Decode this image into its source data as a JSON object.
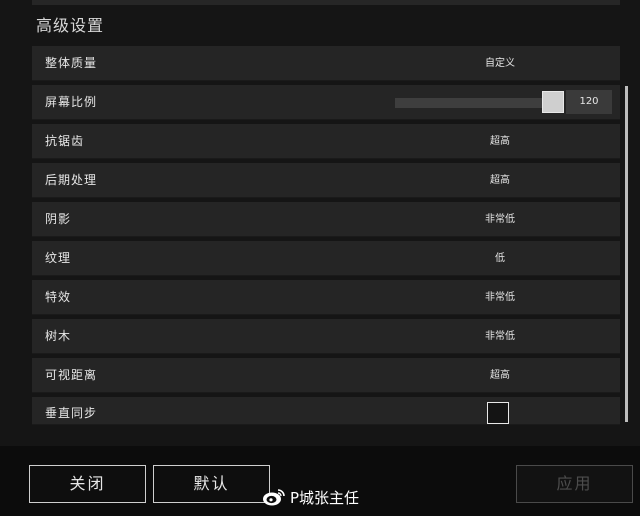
{
  "section": {
    "title": "高级设置"
  },
  "settings": [
    {
      "label": "整体质量",
      "value": "自定义"
    },
    {
      "label": "屏幕比例",
      "value": "120",
      "type": "slider",
      "level": 120
    },
    {
      "label": "抗锯齿",
      "value": "超高"
    },
    {
      "label": "后期处理",
      "value": "超高"
    },
    {
      "label": "阴影",
      "value": "非常低"
    },
    {
      "label": "纹理",
      "value": "低"
    },
    {
      "label": "特效",
      "value": "非常低"
    },
    {
      "label": "树木",
      "value": "非常低"
    },
    {
      "label": "可视距离",
      "value": "超高"
    },
    {
      "label": "垂直同步",
      "type": "checkbox",
      "checked": false
    }
  ],
  "footer": {
    "close_label": "关闭",
    "default_label": "默认",
    "apply_label": "应用"
  },
  "watermark": {
    "text": "P城张主任",
    "icon": "weibo-icon"
  },
  "colors": {
    "panel_bg": "#151515",
    "row_bg": "#252525",
    "text": "#e6e6e6",
    "disabled_text": "#4d4d4d"
  }
}
